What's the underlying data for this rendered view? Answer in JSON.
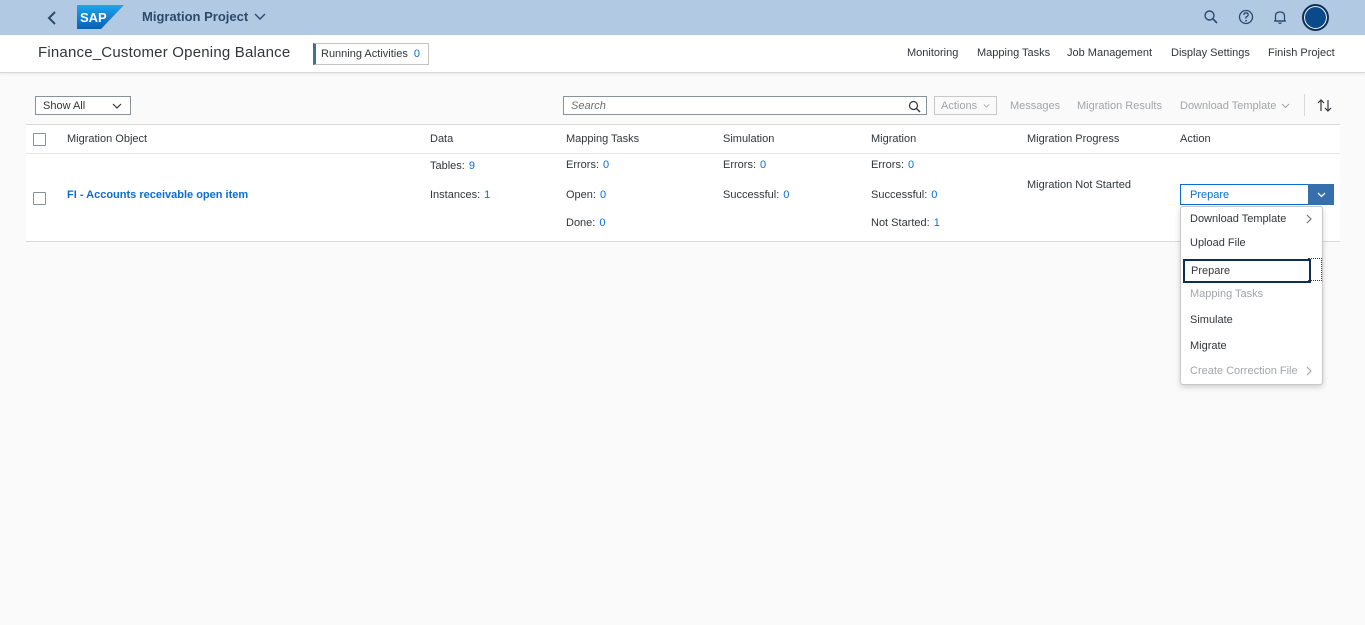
{
  "shell": {
    "title": "Migration Project",
    "logo_text": "SAP"
  },
  "header": {
    "project_title": "Finance_Customer Opening Balance",
    "running_label": "Running Activities",
    "running_count": "0",
    "nav": [
      "Monitoring",
      "Mapping Tasks",
      "Job Management",
      "Display Settings",
      "Finish Project"
    ]
  },
  "toolbar": {
    "filter_value": "Show All",
    "search_placeholder": "Search",
    "actions_label": "Actions",
    "messages_label": "Messages",
    "migration_results_label": "Migration Results",
    "download_template_label": "Download Template"
  },
  "table": {
    "columns": [
      "Migration Object",
      "Data",
      "Mapping Tasks",
      "Simulation",
      "Migration",
      "Migration Progress",
      "Action"
    ],
    "row": {
      "object": "FI - Accounts receivable open item",
      "data": {
        "tables_label": "Tables:",
        "tables_value": "9",
        "instances_label": "Instances:",
        "instances_value": "1"
      },
      "mapping": {
        "errors_label": "Errors:",
        "errors_value": "0",
        "open_label": "Open:",
        "open_value": "0",
        "done_label": "Done:",
        "done_value": "0"
      },
      "simulation": {
        "errors_label": "Errors:",
        "errors_value": "0",
        "successful_label": "Successful:",
        "successful_value": "0"
      },
      "migration": {
        "errors_label": "Errors:",
        "errors_value": "0",
        "successful_label": "Successful:",
        "successful_value": "0",
        "notstarted_label": "Not Started:",
        "notstarted_value": "1"
      },
      "progress": "Migration Not Started",
      "action": "Prepare"
    }
  },
  "menu": {
    "items": [
      {
        "label": "Download Template",
        "disabled": false,
        "submenu": true
      },
      {
        "label": "Upload File",
        "disabled": false,
        "submenu": false
      },
      {
        "label": "Prepare",
        "disabled": false,
        "submenu": false
      },
      {
        "label": "Mapping Tasks",
        "disabled": true,
        "submenu": false
      },
      {
        "label": "Simulate",
        "disabled": false,
        "submenu": false
      },
      {
        "label": "Migrate",
        "disabled": false,
        "submenu": false
      },
      {
        "label": "Create Correction File",
        "disabled": true,
        "submenu": true
      }
    ]
  },
  "colors": {
    "shell_bg": "#b2c9e3",
    "accent": "#0a6ed1",
    "split_arrow": "#3570ad"
  }
}
